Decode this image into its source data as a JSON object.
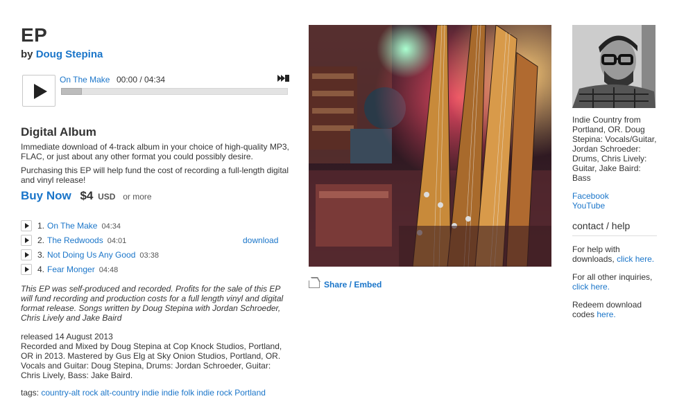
{
  "album": {
    "title": "EP",
    "by_prefix": "by",
    "artist": "Doug Stepina"
  },
  "player": {
    "track": "On The Make",
    "time": "00:00 / 04:34",
    "progress": 0
  },
  "buy": {
    "heading": "Digital Album",
    "desc1": "Immediate download of 4-track album in your choice of high-quality MP3, FLAC, or just about any other format you could possibly desire.",
    "desc2": "Purchasing this EP will help fund the cost of recording a full-length digital and vinyl release!",
    "buy_now": "Buy Now",
    "price": "$4",
    "currency": "USD",
    "or_more": "or more"
  },
  "tracks": [
    {
      "num": "1.",
      "name": "On The Make",
      "duration": "04:34",
      "download": ""
    },
    {
      "num": "2.",
      "name": "The Redwoods",
      "duration": "04:01",
      "download": "download"
    },
    {
      "num": "3.",
      "name": "Not Doing Us Any Good",
      "duration": "03:38",
      "download": ""
    },
    {
      "num": "4.",
      "name": "Fear Monger",
      "duration": "04:48",
      "download": ""
    }
  ],
  "about": "This EP was self-produced and recorded. Profits for the sale of this EP will fund recording and production costs for a full length vinyl and digital format release. Songs written by Doug Stepina with Jordan Schroeder, Chris Lively and Jake Baird",
  "credits": {
    "released": "released 14 August 2013",
    "text": "Recorded and Mixed by Doug Stepina at Cop Knock Studios, Portland, OR in 2013. Mastered by Gus Elg at Sky Onion Studios, Portland, OR. Vocals and Guitar: Doug Stepina, Drums: Jordan Schroeder, Guitar: Chris Lively, Bass: Jake Baird."
  },
  "tags": {
    "label": "tags:",
    "items": [
      "country-alt",
      "rock",
      "alt-country",
      "indie",
      "indie folk",
      "indie rock",
      "Portland"
    ]
  },
  "share": {
    "label": "Share / Embed"
  },
  "sidebar": {
    "bio": "Indie Country from Portland, OR. Doug Stepina: Vocals/Guitar, Jordan Schroeder: Drums, Chris Lively: Guitar, Jake Baird: Bass",
    "links": [
      "Facebook",
      "YouTube"
    ],
    "contact_heading": "contact / help",
    "help_text": "For help with downloads,",
    "help_link": "click here.",
    "other_text": "For all other inquiries,",
    "other_link": "click here.",
    "redeem_text": "Redeem download codes",
    "redeem_link": "here."
  }
}
